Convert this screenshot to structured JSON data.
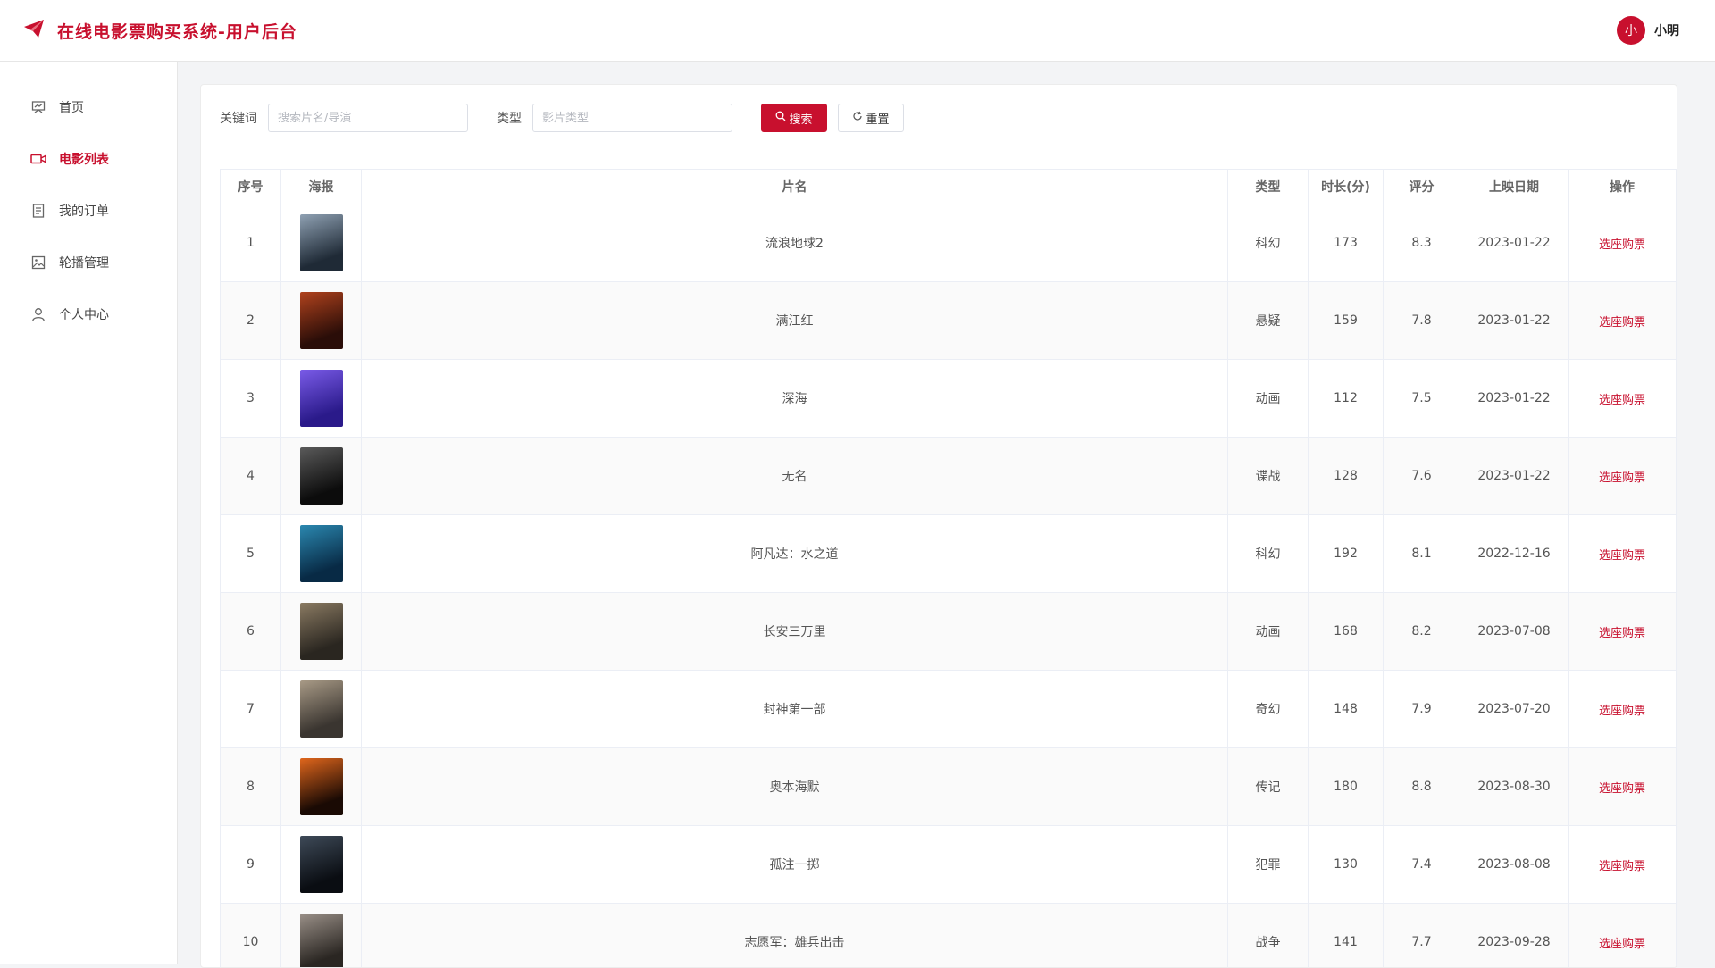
{
  "header": {
    "title": "在线电影票购买系统-用户后台",
    "avatar_text": "小",
    "username": "小明",
    "accent_color": "#c8102e"
  },
  "sidebar": {
    "items": [
      {
        "label": "首页",
        "icon": "home-icon",
        "active": false
      },
      {
        "label": "电影列表",
        "icon": "video-camera-icon",
        "active": true
      },
      {
        "label": "我的订单",
        "icon": "document-icon",
        "active": false
      },
      {
        "label": "轮播管理",
        "icon": "image-icon",
        "active": false
      },
      {
        "label": "个人中心",
        "icon": "user-icon",
        "active": false
      }
    ]
  },
  "search": {
    "keyword_label": "关键词",
    "keyword_placeholder": "搜索片名/导演",
    "type_label": "类型",
    "type_placeholder": "影片类型",
    "search_button": "搜索",
    "reset_button": "重置"
  },
  "table": {
    "columns": [
      "序号",
      "海报",
      "片名",
      "类型",
      "时长(分)",
      "评分",
      "上映日期",
      "操作"
    ],
    "action_label": "选座购票",
    "rows": [
      {
        "index": "1",
        "title": "流浪地球2",
        "type": "科幻",
        "duration": "173",
        "rating": "8.3",
        "date": "2023-01-22",
        "poster_colors": [
          "#1f2a36",
          "#8fa1b3"
        ]
      },
      {
        "index": "2",
        "title": "满江红",
        "type": "悬疑",
        "duration": "159",
        "rating": "7.8",
        "date": "2023-01-22",
        "poster_colors": [
          "#2a0d08",
          "#b0421d"
        ]
      },
      {
        "index": "3",
        "title": "深海",
        "type": "动画",
        "duration": "112",
        "rating": "7.5",
        "date": "2023-01-22",
        "poster_colors": [
          "#2a1a8a",
          "#7a5be8"
        ]
      },
      {
        "index": "4",
        "title": "无名",
        "type": "谍战",
        "duration": "128",
        "rating": "7.6",
        "date": "2023-01-22",
        "poster_colors": [
          "#0c0c0c",
          "#5a5a5a"
        ]
      },
      {
        "index": "5",
        "title": "阿凡达：水之道",
        "type": "科幻",
        "duration": "192",
        "rating": "8.1",
        "date": "2022-12-16",
        "poster_colors": [
          "#082a45",
          "#2b88b0"
        ]
      },
      {
        "index": "6",
        "title": "长安三万里",
        "type": "动画",
        "duration": "168",
        "rating": "8.2",
        "date": "2023-07-08",
        "poster_colors": [
          "#2a2620",
          "#8a7a62"
        ]
      },
      {
        "index": "7",
        "title": "封神第一部",
        "type": "奇幻",
        "duration": "148",
        "rating": "7.9",
        "date": "2023-07-20",
        "poster_colors": [
          "#3a3530",
          "#a89a86"
        ]
      },
      {
        "index": "8",
        "title": "奥本海默",
        "type": "传记",
        "duration": "180",
        "rating": "8.8",
        "date": "2023-08-30",
        "poster_colors": [
          "#1a0a04",
          "#e0661c"
        ]
      },
      {
        "index": "9",
        "title": "孤注一掷",
        "type": "犯罪",
        "duration": "130",
        "rating": "7.4",
        "date": "2023-08-08",
        "poster_colors": [
          "#0a0d12",
          "#3e4a58"
        ]
      },
      {
        "index": "10",
        "title": "志愿军：雄兵出击",
        "type": "战争",
        "duration": "141",
        "rating": "7.7",
        "date": "2023-09-28",
        "poster_colors": [
          "#2a2622",
          "#9a9088"
        ]
      }
    ]
  }
}
